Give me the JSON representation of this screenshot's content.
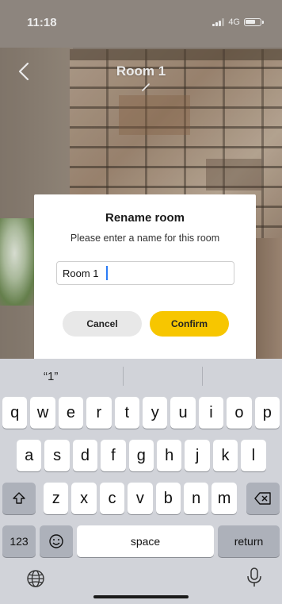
{
  "status_bar": {
    "time": "11:18",
    "network": "4G"
  },
  "header": {
    "title": "Room 1",
    "back_icon": "chevron-left-icon",
    "edit_icon": "pencil-icon"
  },
  "dialog": {
    "title": "Rename room",
    "message": "Please enter a name for this room",
    "input_value": "Room 1",
    "cancel_label": "Cancel",
    "confirm_label": "Confirm",
    "accent_color": "#f7c600"
  },
  "keyboard": {
    "suggestion": "“1”",
    "row1": [
      "q",
      "w",
      "e",
      "r",
      "t",
      "y",
      "u",
      "i",
      "o",
      "p"
    ],
    "row2": [
      "a",
      "s",
      "d",
      "f",
      "g",
      "h",
      "j",
      "k",
      "l"
    ],
    "row3": [
      "z",
      "x",
      "c",
      "v",
      "b",
      "n",
      "m"
    ],
    "numbers_label": "123",
    "space_label": "space",
    "return_label": "return",
    "shift_icon": "shift-icon",
    "delete_icon": "backspace-icon",
    "emoji_icon": "emoji-icon",
    "globe_icon": "globe-icon",
    "mic_icon": "microphone-icon"
  }
}
